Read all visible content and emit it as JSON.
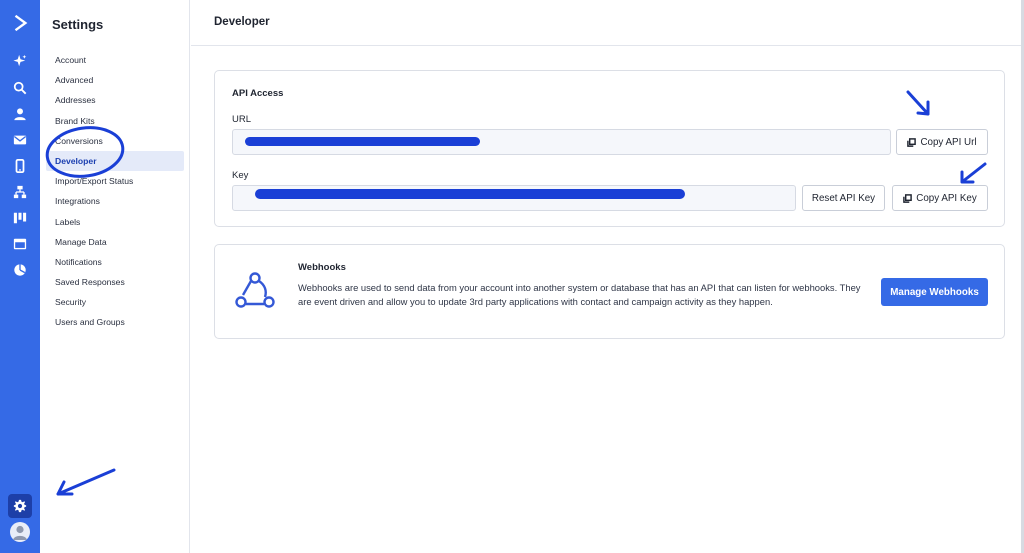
{
  "rail": {
    "icons": [
      "logo-chevron-icon",
      "sparkle-icon",
      "search-icon",
      "contacts-icon",
      "mail-icon",
      "mobile-icon",
      "automation-icon",
      "pipeline-icon",
      "window-icon",
      "reports-icon",
      "gear-icon",
      "avatar-icon"
    ],
    "colors": {
      "background": "#356ae6",
      "active_item": "#1d3fa8"
    }
  },
  "sidebar": {
    "title": "Settings",
    "items": [
      {
        "label": "Account"
      },
      {
        "label": "Advanced"
      },
      {
        "label": "Addresses"
      },
      {
        "label": "Brand Kits"
      },
      {
        "label": "Conversions"
      },
      {
        "label": "Developer",
        "active": true
      },
      {
        "label": "Import/Export Status"
      },
      {
        "label": "Integrations"
      },
      {
        "label": "Labels"
      },
      {
        "label": "Manage Data"
      },
      {
        "label": "Notifications"
      },
      {
        "label": "Saved Responses"
      },
      {
        "label": "Security"
      },
      {
        "label": "Users and Groups"
      }
    ]
  },
  "page": {
    "title": "Developer"
  },
  "api_access": {
    "title": "API Access",
    "url_label": "URL",
    "url_value": "",
    "key_label": "Key",
    "key_value": "",
    "copy_url_label": "Copy API Url",
    "reset_key_label": "Reset API Key",
    "copy_key_label": "Copy API Key"
  },
  "webhooks": {
    "title": "Webhooks",
    "description": "Webhooks are used to send data from your account into another system or database that has an API that can listen for webhooks. They are event driven and allow you to update 3rd party applications with contact and campaign activity as they happen.",
    "button_label": "Manage Webhooks"
  },
  "colors": {
    "accent": "#356ae6",
    "annotation": "#1a3fd6",
    "active_nav_bg": "#e4eaf9"
  }
}
